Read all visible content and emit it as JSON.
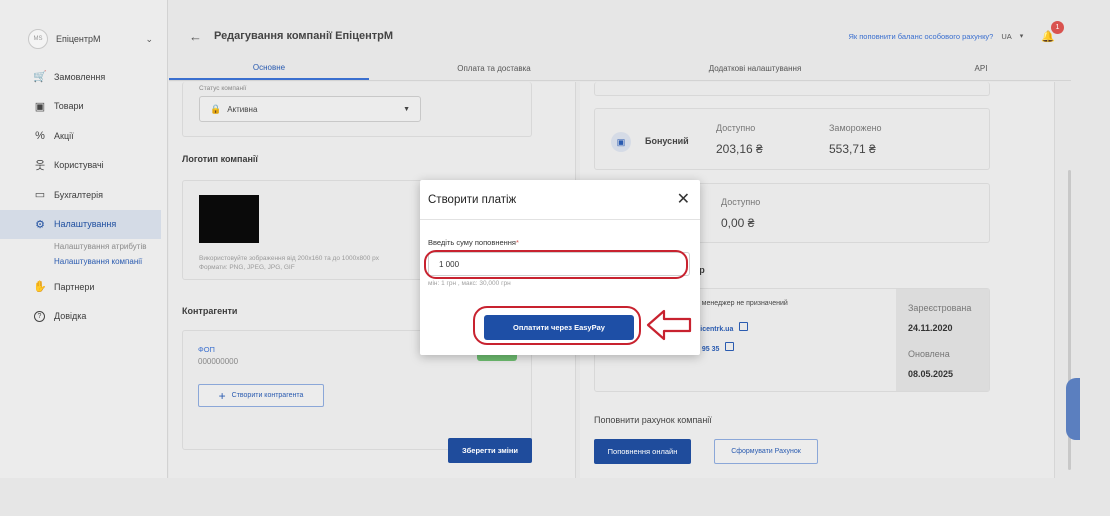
{
  "sidebar": {
    "company_name": "ЕпіцентрМ",
    "logo_text": "MS",
    "items": [
      {
        "label": "Замовлення",
        "icon": "cart-icon",
        "glyph": "🛒"
      },
      {
        "label": "Товари",
        "icon": "box-icon",
        "glyph": "▣"
      },
      {
        "label": "Акції",
        "icon": "tag-icon",
        "glyph": "%"
      },
      {
        "label": "Користувачі",
        "icon": "user-icon",
        "glyph": "웃"
      },
      {
        "label": "Бухгалтерія",
        "icon": "wallet-icon",
        "glyph": "▭"
      },
      {
        "label": "Налаштування",
        "icon": "gear-icon",
        "glyph": "⚙"
      }
    ],
    "subitems": [
      "Налаштування атрибутів",
      "Налаштування компанії"
    ],
    "items_after": [
      {
        "label": "Партнери",
        "icon": "handshake-icon",
        "glyph": "✋"
      },
      {
        "label": "Довідка",
        "icon": "help-icon",
        "glyph": "?"
      }
    ]
  },
  "header": {
    "title": "Редагування компанії ЕпіцентрМ",
    "help_link": "Як поповнити баланс особового рахунку?",
    "lang": "UA",
    "notifications": "1"
  },
  "tabs": [
    {
      "label": "Основне",
      "active": true
    },
    {
      "label": "Оплата та доставка",
      "active": false
    },
    {
      "label": "Додаткові налаштування",
      "active": false
    },
    {
      "label": "API",
      "active": false
    }
  ],
  "left": {
    "status_label": "Статус компанії",
    "status_value": "Активна",
    "logo_title": "Логотип компанії",
    "logo_hint_1": "Використовуйте зображення від 200х160 та до 1000х800 px",
    "logo_hint_2": "Формати: PNG, JPEG, JPG, GIF",
    "contractors_title": "Контрагенти",
    "contractor_type": "ФОП",
    "contractor_code": "000000000",
    "create_contractor": "Створити контрагента",
    "save_changes": "Зберегти зміни"
  },
  "right": {
    "bonus_name": "Бонусний",
    "available_label": "Доступно",
    "frozen_label": "Заморожено",
    "bonus_available": "203,16 ₴",
    "bonus_frozen": "553,71 ₴",
    "second_available_label": "Доступно",
    "second_available": "0,00 ₴",
    "manager_title": "жер",
    "manager_text": "ний менеджер не призначений",
    "manager_email": "picentrk.ua",
    "manager_phone": "2 95 35",
    "registered_label": "Зареєстрована",
    "registered_date": "24.11.2020",
    "updated_label": "Оновлена",
    "updated_date": "08.05.2025",
    "topup_title": "Поповнити рахунок компанії",
    "topup_online": "Поповнення онлайн",
    "form_invoice": "Сформувати Рахунок"
  },
  "modal": {
    "title": "Створити платіж",
    "amount_label": "Введіть суму поповнення",
    "amount_required": "*",
    "amount_value": "1 000",
    "amount_hint": "мін: 1 грн , макс: 30,000 грн",
    "pay_button": "Оплатити через EasyPay"
  },
  "colors": {
    "accent": "#1e4fa6",
    "annotation": "#c8222f",
    "link": "#3a6fcf"
  }
}
